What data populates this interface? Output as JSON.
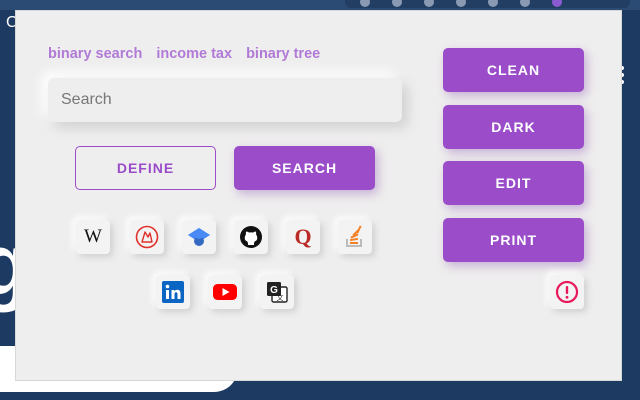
{
  "background": {
    "left_letter": "C",
    "big_glyph": "g"
  },
  "popup": {
    "suggestions": [
      "binary search",
      "income tax",
      "binary tree"
    ],
    "search": {
      "placeholder": "Search",
      "value": ""
    },
    "buttons": {
      "define": "DEFINE",
      "search": "SEARCH",
      "clean": "CLEAN",
      "dark": "DARK",
      "edit": "EDIT",
      "print": "PRINT"
    },
    "icons": {
      "wikipedia": {
        "label": "W"
      },
      "quora": {
        "label": "Q"
      }
    },
    "colors": {
      "accent": "#9a4cc9",
      "suggestion": "#b07ad6",
      "panel_bg": "#efeeee"
    }
  }
}
